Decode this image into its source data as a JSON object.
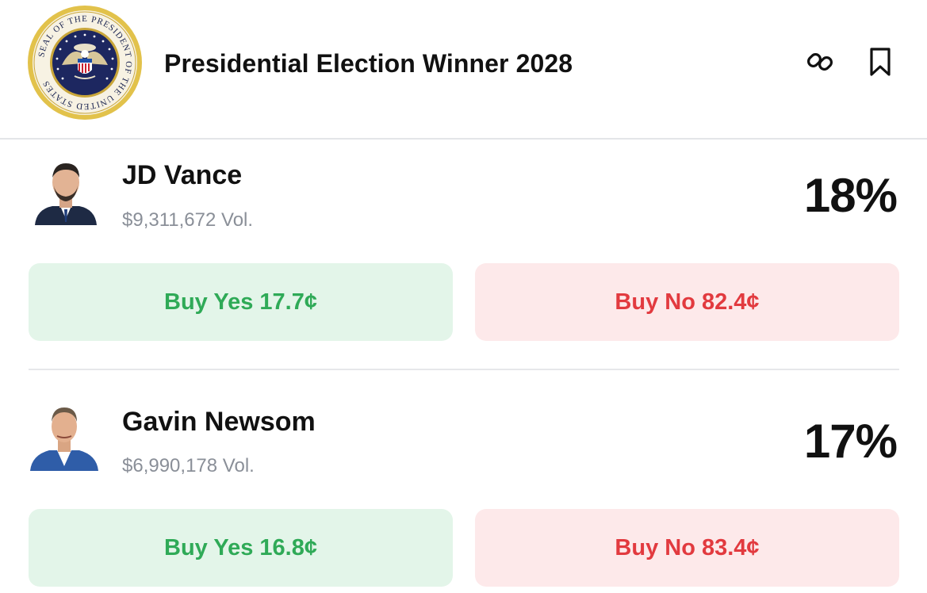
{
  "header": {
    "title": "Presidential Election Winner 2028",
    "seal_text": "SEAL OF THE PRESIDENT OF THE UNITED STATES",
    "icons": [
      "link-icon",
      "bookmark-icon"
    ]
  },
  "candidates": [
    {
      "name": "JD Vance",
      "volume": "$9,311,672 Vol.",
      "percent": "18%",
      "buy_yes": "Buy Yes 17.7¢",
      "buy_no": "Buy No 82.4¢"
    },
    {
      "name": "Gavin Newsom",
      "volume": "$6,990,178 Vol.",
      "percent": "17%",
      "buy_yes": "Buy Yes 16.8¢",
      "buy_no": "Buy No 83.4¢"
    }
  ],
  "colors": {
    "yes_text": "#2faa57",
    "yes_bg": "#e3f5e9",
    "no_text": "#e23a3f",
    "no_bg": "#fde9ea"
  }
}
